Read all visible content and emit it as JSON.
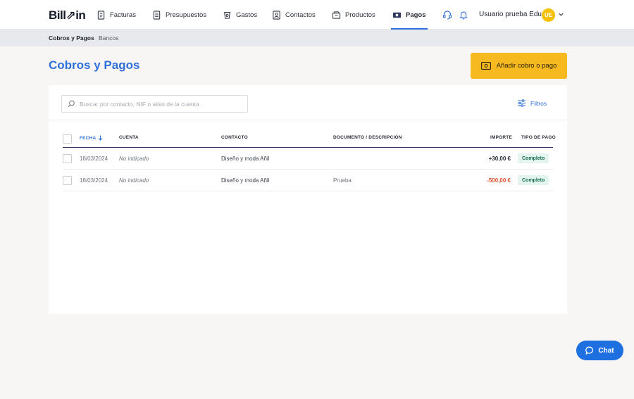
{
  "brand": {
    "logo_text": "Bill⇗in",
    "accent": "#2f6fdc",
    "highlight": "#f6b91f"
  },
  "nav": {
    "items": [
      {
        "label": "Facturas",
        "icon": "invoice-icon"
      },
      {
        "label": "Presupuestos",
        "icon": "quote-icon"
      },
      {
        "label": "Gastos",
        "icon": "expense-icon"
      },
      {
        "label": "Contactos",
        "icon": "contacts-icon"
      },
      {
        "label": "Productos",
        "icon": "products-icon"
      },
      {
        "label": "Pagos",
        "icon": "payments-icon",
        "active": true
      }
    ],
    "user_name": "Usuario prueba Edu",
    "user_initials": "UE"
  },
  "subnav": {
    "items": [
      "Cobros y Pagos",
      "Bancos"
    ]
  },
  "page": {
    "title": "Cobros y Pagos",
    "add_button_label": "Añadir cobro o pago"
  },
  "toolbar": {
    "search_placeholder": "Buscar por contacto, NIF o alias de la cuenta",
    "filters_label": "Filtros"
  },
  "table": {
    "headers": {
      "fecha": "FECHA",
      "cuenta": "CUENTA",
      "contacto": "CONTACTO",
      "documento": "DOCUMENTO / DESCRIPCIÓN",
      "importe": "IMPORTE",
      "tipo": "TIPO DE PAGO"
    },
    "rows": [
      {
        "fecha": "18/03/2024",
        "cuenta": "No indicado",
        "contacto": "Diseño y moda Añil",
        "documento": "",
        "importe": "+30,00 €",
        "tipo": "Completo"
      },
      {
        "fecha": "18/03/2024",
        "cuenta": "No indicado",
        "contacto": "Diseño y moda Añil",
        "documento": "Prueba",
        "importe": "-500,00 €",
        "tipo": "Completo"
      }
    ]
  },
  "chat": {
    "label": "Chat"
  }
}
